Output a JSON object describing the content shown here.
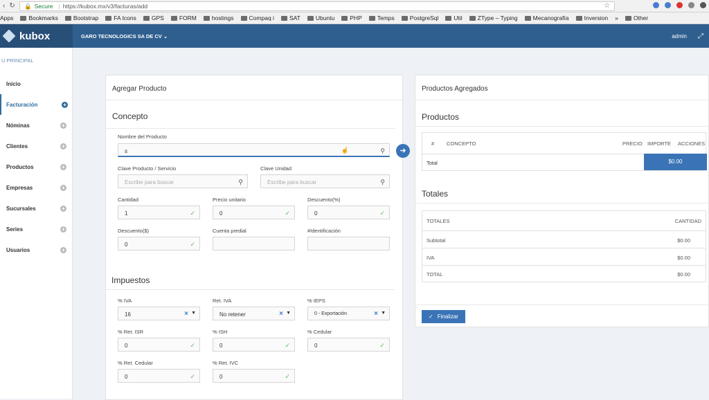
{
  "browser": {
    "secure_label": "Secure",
    "url": "https://kubox.mx/v3/facturas/add",
    "bookmarks": [
      "Apps",
      "Bookmarks",
      "Bootstrap",
      "FA Icons",
      "GPS",
      "FORM",
      "hostings",
      "Compaq i",
      "SAT",
      "Ubuntu",
      "PHP",
      "Temps",
      "PostgreSql",
      "Util",
      "ZType – Typing",
      "Mecanografía",
      "Inversion",
      "»",
      "Other"
    ]
  },
  "topbar": {
    "app_name": "kubox",
    "company": "GARO TECNOLOGICS SA DE CV",
    "user": "admin"
  },
  "sidebar": {
    "title": "U PRINCIPAL",
    "items": [
      {
        "label": "Inicio"
      },
      {
        "label": "Facturación"
      },
      {
        "label": "Nóminas"
      },
      {
        "label": "Clientes"
      },
      {
        "label": "Productos"
      },
      {
        "label": "Empresas"
      },
      {
        "label": "Sucursales"
      },
      {
        "label": "Series"
      },
      {
        "label": "Usuarios"
      }
    ]
  },
  "add_product": {
    "title": "Agregar Producto",
    "concepto": "Concepto",
    "nombre_label": "Nombre del Producto",
    "nombre_value": "s",
    "clave_prod_label": "Clave Producto / Servicio",
    "clave_prod_placeholder": "Escribe para buscar",
    "clave_unidad_label": "Clave Unidad",
    "clave_unidad_placeholder": "Escribe para buscar",
    "cantidad_label": "Cantidad",
    "cantidad_value": "1",
    "precio_label": "Precio unitario",
    "precio_value": "0",
    "descpct_label": "Descuento(%)",
    "descpct_value": "0",
    "descamt_label": "Descuento($)",
    "descamt_value": "0",
    "cuenta_label": "Cuenta predial",
    "ident_label": "#Identificación",
    "impuestos": "Impuestos",
    "iva_label": "% IVA",
    "iva_value": "16",
    "retiva_label": "Ret. IVA",
    "retiva_value": "No retener",
    "ieps_label": "% IEPS",
    "ieps_value": "0 - Exportación",
    "retisr_label": "% Ret. ISR",
    "retisr_value": "0",
    "ish_label": "% ISH",
    "ish_value": "0",
    "cedular_label": "% Cedular",
    "cedular_value": "0",
    "retced_label": "% Ret. Cedular",
    "retced_value": "0",
    "retivc_label": "% Ret. IVC",
    "retivc_value": "0"
  },
  "added_products": {
    "title": "Productos Agregados",
    "productos": "Productos",
    "columns": [
      "#",
      "CONCEPTO",
      "PRECIO",
      "IMPORTE",
      "ACCIONES"
    ],
    "total_label": "Total",
    "total_value": "$0.00",
    "totales": "Totales",
    "totals_header": [
      "TOTALES",
      "CANTIDAD"
    ],
    "totals_rows": [
      {
        "label": "Subtotal",
        "value": "$0.00"
      },
      {
        "label": "IVA",
        "value": "$0.00"
      },
      {
        "label": "TOTAL",
        "value": "$0.00"
      }
    ],
    "finalize_label": "Finalizar"
  }
}
